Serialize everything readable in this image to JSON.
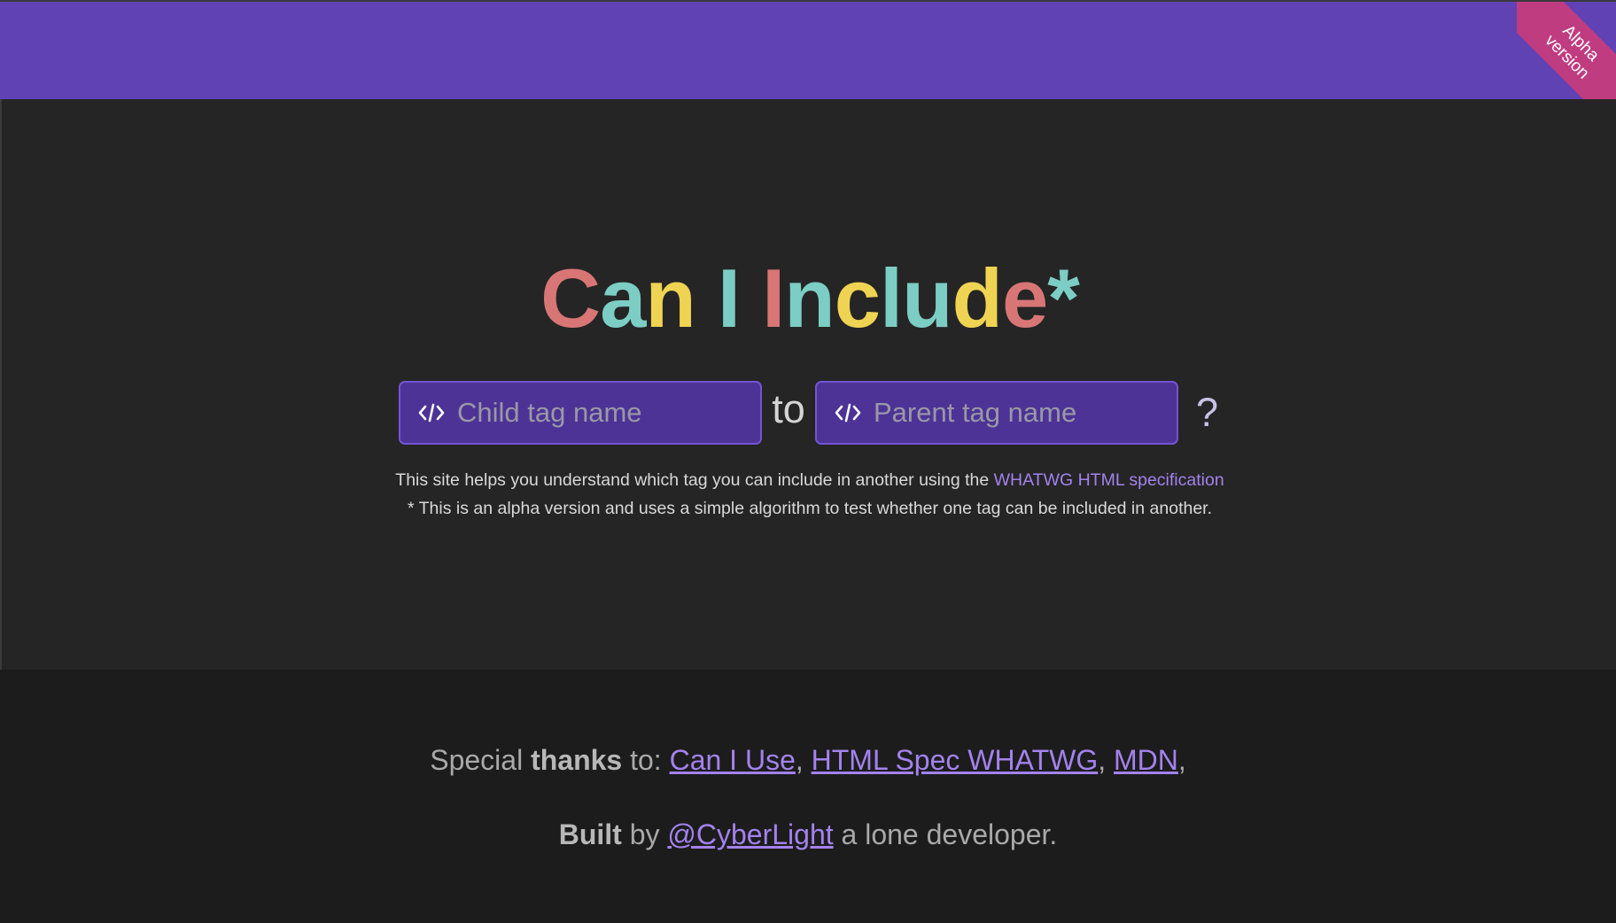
{
  "ribbon": {
    "text": "Alpha\nversion"
  },
  "title": {
    "segments": [
      {
        "text": "C",
        "color": "#d87676"
      },
      {
        "text": "a",
        "color": "#7ccdc4"
      },
      {
        "text": "n",
        "color": "#efd352"
      },
      {
        "text": " ",
        "color": "#ffffff"
      },
      {
        "text": "I",
        "color": "#7ccdc4"
      },
      {
        "text": " ",
        "color": "#ffffff"
      },
      {
        "text": "I",
        "color": "#d87676"
      },
      {
        "text": "n",
        "color": "#7ccdc4"
      },
      {
        "text": "c",
        "color": "#efd352"
      },
      {
        "text": "l",
        "color": "#7ccdc4"
      },
      {
        "text": "u",
        "color": "#7ccdc4"
      },
      {
        "text": "d",
        "color": "#efd352"
      },
      {
        "text": "e",
        "color": "#d87676"
      },
      {
        "text": "*",
        "color": "#7ccdc4"
      }
    ]
  },
  "form": {
    "child_placeholder": "Child tag name",
    "child_value": "",
    "to_word": "to",
    "parent_placeholder": "Parent tag name",
    "parent_value": "",
    "question_mark": "?",
    "icon": "code-icon"
  },
  "description": {
    "line1_text": "This site helps you understand which tag you can include in another using the ",
    "line1_link": "WHATWG HTML specification",
    "line2": "* This is an alpha version and uses a simple algorithm to test whether one tag can be included in another."
  },
  "footer": {
    "thanks_prefix": "Special ",
    "thanks_bold": "thanks",
    "thanks_suffix": " to: ",
    "links": [
      "Can I Use",
      "HTML Spec WHATWG",
      "MDN"
    ],
    "sep": ", ",
    "trailing": ",",
    "built_bold": "Built",
    "built_by": " by ",
    "author_link": "@CyberLight",
    "built_suffix": " a lone developer."
  },
  "colors": {
    "brand": "#6042b4",
    "accent_link": "#a382ee",
    "ribbon": "#c03c80"
  }
}
